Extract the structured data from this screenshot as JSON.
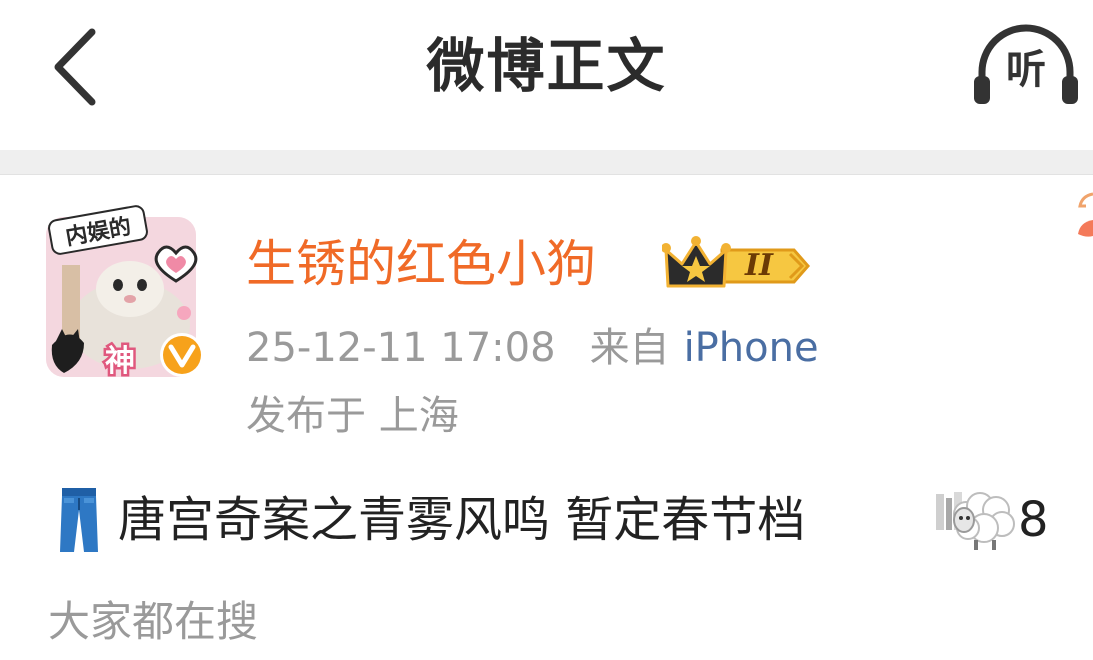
{
  "header": {
    "title": "微博正文",
    "back_icon": "chevron-left-icon",
    "listen_label": "听",
    "listen_icon": "headphones-icon"
  },
  "author": {
    "name": "生锈的红色小狗",
    "name_color": "#f06a27",
    "avatar_caption_top": "内娱的",
    "avatar_caption_bottom": "神",
    "verified_icon": "verified-v-icon",
    "member_badge_icon": "crown-icon",
    "member_level": "II"
  },
  "meta": {
    "datetime": "25-12-11 17:08",
    "from_label": "来自",
    "device": "iPhone",
    "device_color": "#4a6ea3",
    "location": "发布于 上海"
  },
  "post": {
    "lead_icon": "jeans-icon",
    "text": "唐宫奇案之青雾风鸣 暂定春节档",
    "trail_icon_1": "pixel-blocks-icon",
    "trail_icon_2": "sheep-icon",
    "trail_number": "8"
  },
  "section": {
    "search_label": "大家都在搜"
  }
}
